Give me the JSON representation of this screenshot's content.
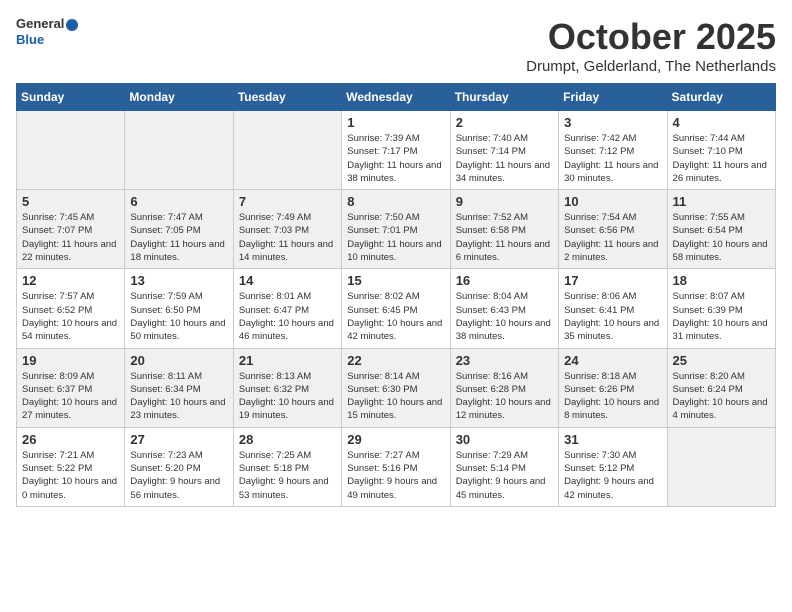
{
  "logo": {
    "general": "General",
    "blue": "Blue"
  },
  "title": "October 2025",
  "subtitle": "Drumpt, Gelderland, The Netherlands",
  "days_of_week": [
    "Sunday",
    "Monday",
    "Tuesday",
    "Wednesday",
    "Thursday",
    "Friday",
    "Saturday"
  ],
  "weeks": [
    [
      {
        "day": "",
        "info": ""
      },
      {
        "day": "",
        "info": ""
      },
      {
        "day": "",
        "info": ""
      },
      {
        "day": "1",
        "info": "Sunrise: 7:39 AM\nSunset: 7:17 PM\nDaylight: 11 hours and 38 minutes."
      },
      {
        "day": "2",
        "info": "Sunrise: 7:40 AM\nSunset: 7:14 PM\nDaylight: 11 hours and 34 minutes."
      },
      {
        "day": "3",
        "info": "Sunrise: 7:42 AM\nSunset: 7:12 PM\nDaylight: 11 hours and 30 minutes."
      },
      {
        "day": "4",
        "info": "Sunrise: 7:44 AM\nSunset: 7:10 PM\nDaylight: 11 hours and 26 minutes."
      }
    ],
    [
      {
        "day": "5",
        "info": "Sunrise: 7:45 AM\nSunset: 7:07 PM\nDaylight: 11 hours and 22 minutes."
      },
      {
        "day": "6",
        "info": "Sunrise: 7:47 AM\nSunset: 7:05 PM\nDaylight: 11 hours and 18 minutes."
      },
      {
        "day": "7",
        "info": "Sunrise: 7:49 AM\nSunset: 7:03 PM\nDaylight: 11 hours and 14 minutes."
      },
      {
        "day": "8",
        "info": "Sunrise: 7:50 AM\nSunset: 7:01 PM\nDaylight: 11 hours and 10 minutes."
      },
      {
        "day": "9",
        "info": "Sunrise: 7:52 AM\nSunset: 6:58 PM\nDaylight: 11 hours and 6 minutes."
      },
      {
        "day": "10",
        "info": "Sunrise: 7:54 AM\nSunset: 6:56 PM\nDaylight: 11 hours and 2 minutes."
      },
      {
        "day": "11",
        "info": "Sunrise: 7:55 AM\nSunset: 6:54 PM\nDaylight: 10 hours and 58 minutes."
      }
    ],
    [
      {
        "day": "12",
        "info": "Sunrise: 7:57 AM\nSunset: 6:52 PM\nDaylight: 10 hours and 54 minutes."
      },
      {
        "day": "13",
        "info": "Sunrise: 7:59 AM\nSunset: 6:50 PM\nDaylight: 10 hours and 50 minutes."
      },
      {
        "day": "14",
        "info": "Sunrise: 8:01 AM\nSunset: 6:47 PM\nDaylight: 10 hours and 46 minutes."
      },
      {
        "day": "15",
        "info": "Sunrise: 8:02 AM\nSunset: 6:45 PM\nDaylight: 10 hours and 42 minutes."
      },
      {
        "day": "16",
        "info": "Sunrise: 8:04 AM\nSunset: 6:43 PM\nDaylight: 10 hours and 38 minutes."
      },
      {
        "day": "17",
        "info": "Sunrise: 8:06 AM\nSunset: 6:41 PM\nDaylight: 10 hours and 35 minutes."
      },
      {
        "day": "18",
        "info": "Sunrise: 8:07 AM\nSunset: 6:39 PM\nDaylight: 10 hours and 31 minutes."
      }
    ],
    [
      {
        "day": "19",
        "info": "Sunrise: 8:09 AM\nSunset: 6:37 PM\nDaylight: 10 hours and 27 minutes."
      },
      {
        "day": "20",
        "info": "Sunrise: 8:11 AM\nSunset: 6:34 PM\nDaylight: 10 hours and 23 minutes."
      },
      {
        "day": "21",
        "info": "Sunrise: 8:13 AM\nSunset: 6:32 PM\nDaylight: 10 hours and 19 minutes."
      },
      {
        "day": "22",
        "info": "Sunrise: 8:14 AM\nSunset: 6:30 PM\nDaylight: 10 hours and 15 minutes."
      },
      {
        "day": "23",
        "info": "Sunrise: 8:16 AM\nSunset: 6:28 PM\nDaylight: 10 hours and 12 minutes."
      },
      {
        "day": "24",
        "info": "Sunrise: 8:18 AM\nSunset: 6:26 PM\nDaylight: 10 hours and 8 minutes."
      },
      {
        "day": "25",
        "info": "Sunrise: 8:20 AM\nSunset: 6:24 PM\nDaylight: 10 hours and 4 minutes."
      }
    ],
    [
      {
        "day": "26",
        "info": "Sunrise: 7:21 AM\nSunset: 5:22 PM\nDaylight: 10 hours and 0 minutes."
      },
      {
        "day": "27",
        "info": "Sunrise: 7:23 AM\nSunset: 5:20 PM\nDaylight: 9 hours and 56 minutes."
      },
      {
        "day": "28",
        "info": "Sunrise: 7:25 AM\nSunset: 5:18 PM\nDaylight: 9 hours and 53 minutes."
      },
      {
        "day": "29",
        "info": "Sunrise: 7:27 AM\nSunset: 5:16 PM\nDaylight: 9 hours and 49 minutes."
      },
      {
        "day": "30",
        "info": "Sunrise: 7:29 AM\nSunset: 5:14 PM\nDaylight: 9 hours and 45 minutes."
      },
      {
        "day": "31",
        "info": "Sunrise: 7:30 AM\nSunset: 5:12 PM\nDaylight: 9 hours and 42 minutes."
      },
      {
        "day": "",
        "info": ""
      }
    ]
  ]
}
